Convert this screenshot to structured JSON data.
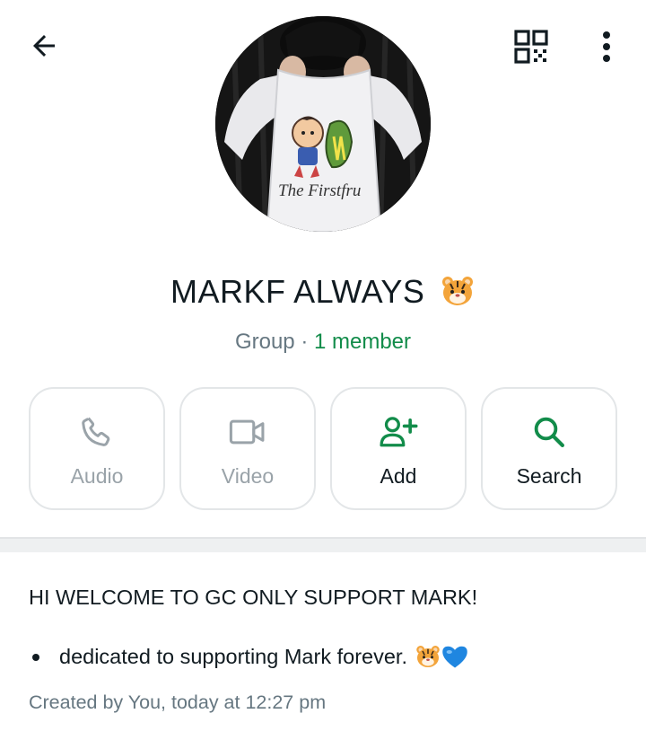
{
  "header": {
    "back_icon": "arrow-left-icon",
    "qr_icon": "qr-code-icon",
    "menu_icon": "more-vert-icon",
    "avatar_print_text": "The Firstfru"
  },
  "group": {
    "name": "MARKF ALWAYS",
    "name_emoji": "tiger-face-icon",
    "type_label": "Group",
    "separator": " · ",
    "members_label": "1 member"
  },
  "actions": [
    {
      "label": "Audio",
      "icon": "phone-icon",
      "enabled": false
    },
    {
      "label": "Video",
      "icon": "video-camera-icon",
      "enabled": false
    },
    {
      "label": "Add",
      "icon": "add-person-icon",
      "enabled": true
    },
    {
      "label": "Search",
      "icon": "search-icon",
      "enabled": true
    }
  ],
  "description": {
    "heading": "HI WELCOME TO GC ONLY SUPPORT MARK!",
    "bullet": "dedicated to supporting Mark forever.",
    "bullet_emojis": [
      "tiger-face-icon",
      "blue-heart-icon"
    ],
    "created": "Created by You, today at 12:27 pm"
  },
  "colors": {
    "accent_green": "#128c4a",
    "muted_text": "#667781",
    "disabled_icon": "#9aa3a9",
    "border": "#e3e6e8"
  }
}
